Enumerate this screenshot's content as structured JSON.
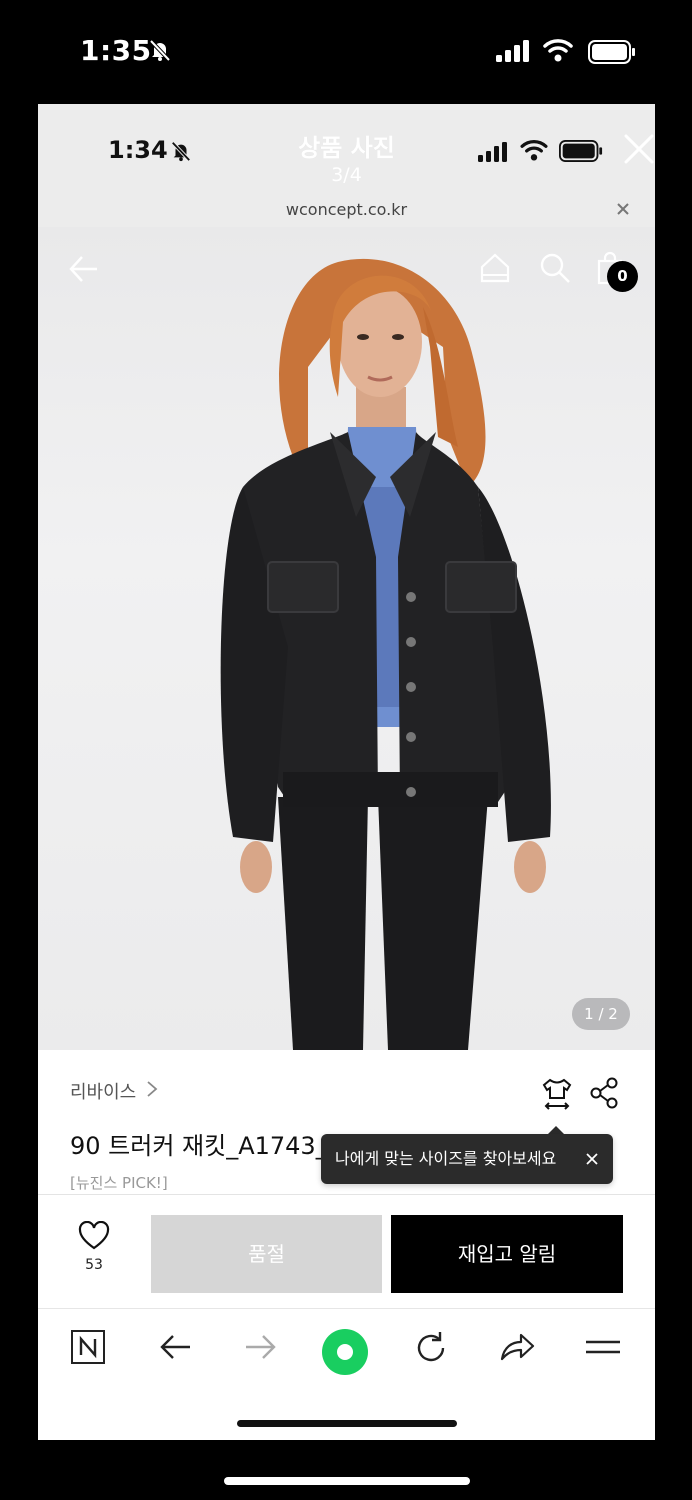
{
  "outer_status": {
    "time": "1:35"
  },
  "viewer": {
    "status_time": "1:34",
    "title": "상품 사진",
    "counter": "3/4",
    "url": "wconcept.co.kr"
  },
  "photo": {
    "cart_count": "0",
    "image_counter": "1 / 2"
  },
  "product": {
    "brand": "리바이스",
    "name": "90 트러커 재킷_A1743_0013",
    "tag": "[뉴진스 PICK!]",
    "size_tooltip": "나에게 맞는 사이즈를 찾아보세요"
  },
  "actions": {
    "like_count": "53",
    "sold_out_label": "품절",
    "restock_label": "재입고 알림"
  },
  "toolbar": {
    "icons": [
      "naver-n-icon",
      "back-arrow-icon",
      "forward-arrow-icon",
      "green-dot-icon",
      "refresh-icon",
      "share-arrow-icon",
      "menu-icon"
    ]
  },
  "colors": {
    "accent_green": "#19ce60",
    "button_black": "#000000",
    "sold_out_gray": "#d6d6d6"
  }
}
